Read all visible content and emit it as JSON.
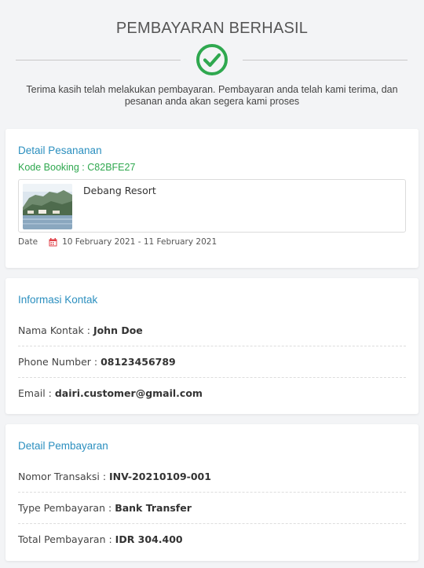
{
  "header": {
    "title": "PEMBAYARAN BERHASIL",
    "message": "Terima kasih telah melakukan pembayaran. Pembayaran anda telah kami terima, dan pesanan anda akan segera kami proses"
  },
  "order": {
    "title": "Detail Pesananan",
    "booking_code": "Kode Booking : C82BFE27",
    "hotel_name": "Debang Resort",
    "date_label": "Date",
    "date_range": "10 February 2021 - 11 February 2021"
  },
  "contact": {
    "title": "Informasi Kontak",
    "rows": [
      {
        "label": "Nama Kontak :",
        "value": "John Doe"
      },
      {
        "label": "Phone Number :",
        "value": "08123456789"
      },
      {
        "label": "Email :",
        "value": "dairi.customer@gmail.com"
      }
    ]
  },
  "payment": {
    "title": "Detail Pembayaran",
    "rows": [
      {
        "label": "Nomor Transaksi :",
        "value": "INV-20210109-001"
      },
      {
        "label": "Type Pembayaran :",
        "value": "Bank Transfer"
      },
      {
        "label": "Total Pembayaran :",
        "value": "IDR 304.400"
      }
    ]
  },
  "colors": {
    "success": "#2fa84f",
    "accent": "#2b8fbf",
    "calendar": "#e0424a"
  },
  "icons": {
    "success": "check-circle-icon",
    "date": "calendar-icon"
  }
}
